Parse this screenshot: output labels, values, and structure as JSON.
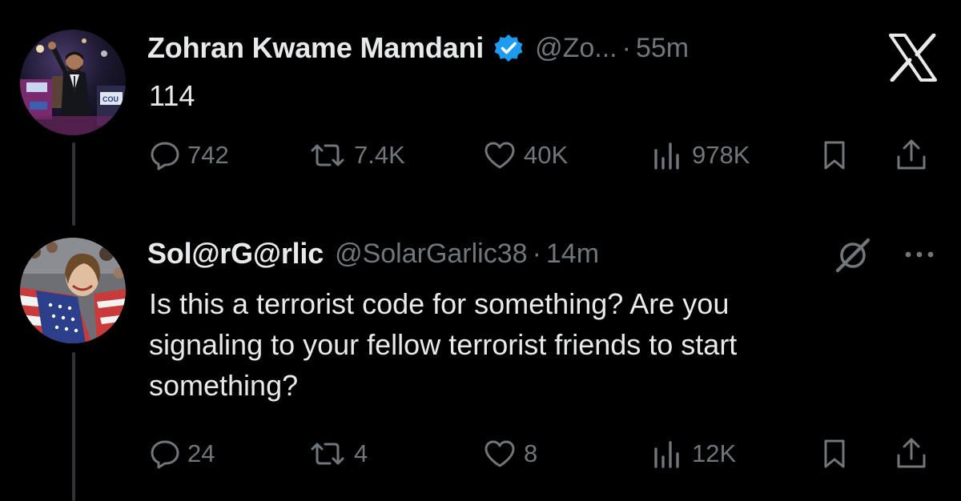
{
  "colors": {
    "background": "#000000",
    "primary_text": "#e7e9ea",
    "secondary_text": "#71767b",
    "verified_badge": "#1d9bf0",
    "thread_line": "#2f3336"
  },
  "brand_icon": "x-logo",
  "tweets": [
    {
      "author_name": "Zohran Kwame Mamdani",
      "verified": true,
      "handle": "@Zo...",
      "separator": "·",
      "time": "55m",
      "text_lines": [
        "114"
      ],
      "actions": {
        "replies": "742",
        "retweets": "7.4K",
        "likes": "40K",
        "views": "978K"
      }
    },
    {
      "author_name": "Sol@rG@rlic",
      "verified": false,
      "handle": "@SolarGarlic38",
      "separator": "·",
      "time": "14m",
      "text_lines": [
        "Is this a terrorist code for something? Are you",
        "signaling to your fellow terrorist friends to start",
        "something?"
      ],
      "actions": {
        "replies": "24",
        "retweets": "4",
        "likes": "8",
        "views": "12K"
      }
    }
  ]
}
